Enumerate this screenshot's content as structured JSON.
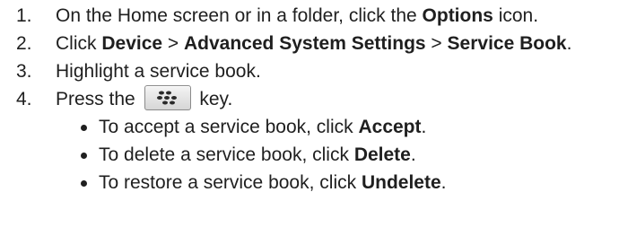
{
  "steps": [
    {
      "number": "1.",
      "pre": "On the Home screen or in a folder, click the ",
      "b1": "Options",
      "post": " icon."
    },
    {
      "number": "2.",
      "pre": "Click ",
      "b1": "Device",
      "sep1": " > ",
      "b2": "Advanced System Settings",
      "sep2": " > ",
      "b3": "Service Book",
      "post": "."
    },
    {
      "number": "3.",
      "text": "Highlight a service book."
    },
    {
      "number": "4.",
      "pre": "Press the ",
      "key_icon": "blackberry-menu-key-icon",
      "post": " key."
    }
  ],
  "bullets": [
    {
      "pre": "To accept a service book, click ",
      "bold": "Accept",
      "post": "."
    },
    {
      "pre": "To delete a service book, click ",
      "bold": "Delete",
      "post": "."
    },
    {
      "pre": "To restore a service book, click ",
      "bold": "Undelete",
      "post": "."
    }
  ]
}
